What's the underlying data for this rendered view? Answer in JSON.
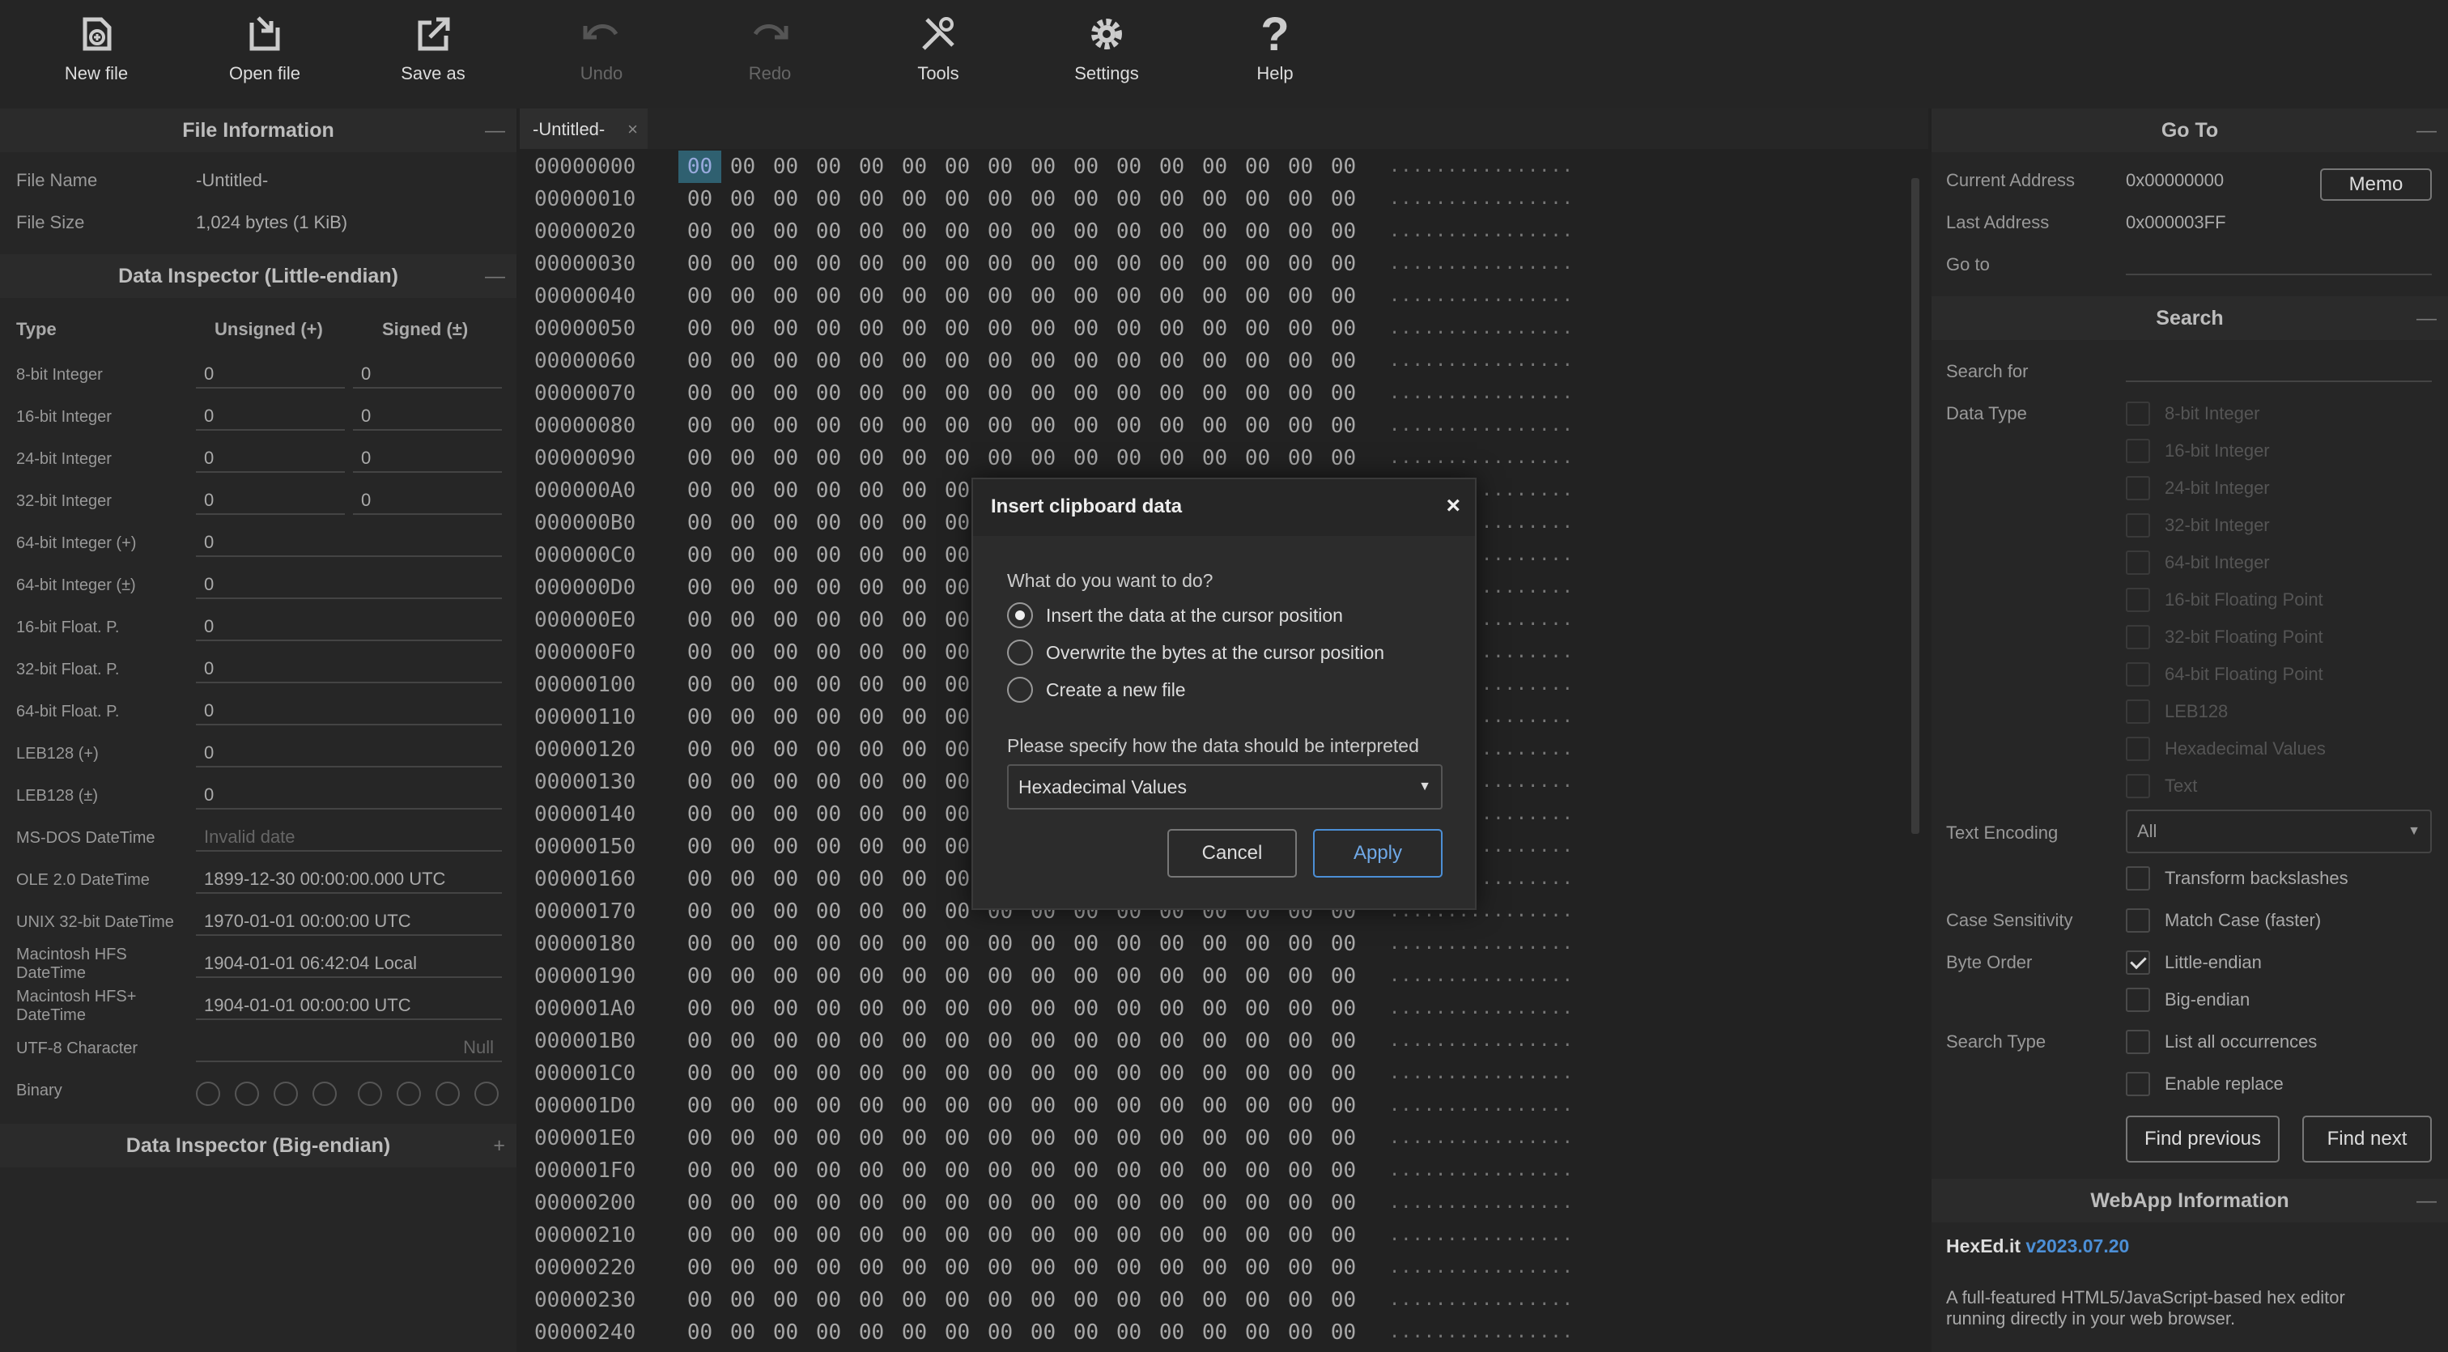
{
  "toolbar": {
    "new_file": "New file",
    "open_file": "Open file",
    "save_as": "Save as",
    "undo": "Undo",
    "redo": "Redo",
    "tools": "Tools",
    "settings": "Settings",
    "help": "Help"
  },
  "file_info": {
    "title": "File Information",
    "collapse": "—",
    "name_label": "File Name",
    "name_value": "-Untitled-",
    "size_label": "File Size",
    "size_value": "1,024 bytes (1 KiB)"
  },
  "inspector_le": {
    "title": "Data Inspector (Little-endian)",
    "collapse": "—",
    "col_type": "Type",
    "col_unsigned": "Unsigned (+)",
    "col_signed": "Signed (±)",
    "rows": [
      {
        "label": "8-bit Integer",
        "unsigned": "0",
        "signed": "0"
      },
      {
        "label": "16-bit Integer",
        "unsigned": "0",
        "signed": "0"
      },
      {
        "label": "24-bit Integer",
        "unsigned": "0",
        "signed": "0"
      },
      {
        "label": "32-bit Integer",
        "unsigned": "0",
        "signed": "0"
      },
      {
        "label": "64-bit Integer (+)",
        "value": "0"
      },
      {
        "label": "64-bit Integer (±)",
        "value": "0"
      },
      {
        "label": "16-bit Float. P.",
        "value": "0"
      },
      {
        "label": "32-bit Float. P.",
        "value": "0"
      },
      {
        "label": "64-bit Float. P.",
        "value": "0"
      },
      {
        "label": "LEB128 (+)",
        "value": "0"
      },
      {
        "label": "LEB128 (±)",
        "value": "0"
      },
      {
        "label": "MS-DOS DateTime",
        "value": "Invalid date"
      },
      {
        "label": "OLE 2.0 DateTime",
        "value": "1899-12-30 00:00:00.000 UTC"
      },
      {
        "label": "UNIX 32-bit DateTime",
        "value": "1970-01-01 00:00:00 UTC"
      },
      {
        "label": "Macintosh HFS DateTime",
        "value": "1904-01-01 06:42:04 Local"
      },
      {
        "label": "Macintosh HFS+ DateTime",
        "value": "1904-01-01 00:00:00 UTC"
      },
      {
        "label": "UTF-8 Character",
        "value": "Null"
      },
      {
        "label": "Binary"
      }
    ]
  },
  "inspector_be": {
    "title": "Data Inspector (Big-endian)",
    "expand": "+"
  },
  "editor": {
    "tab_label": "-Untitled-",
    "tab_close": "×",
    "byte": "00",
    "ascii_row": "................",
    "start_offset": 0,
    "bytes_per_row": 16,
    "selected_offset": 0,
    "visible_rows": 37
  },
  "goto": {
    "title": "Go To",
    "collapse": "—",
    "current_label": "Current Address",
    "current_value": "0x00000000",
    "memo_button": "Memo",
    "last_label": "Last Address",
    "last_value": "0x000003FF",
    "goto_label": "Go to",
    "goto_value": ""
  },
  "search": {
    "title": "Search",
    "collapse": "—",
    "search_for_label": "Search for",
    "search_for_value": "",
    "data_type_label": "Data Type",
    "data_types": [
      "8-bit Integer",
      "16-bit Integer",
      "24-bit Integer",
      "32-bit Integer",
      "64-bit Integer",
      "16-bit Floating Point",
      "32-bit Floating Point",
      "64-bit Floating Point",
      "LEB128",
      "Hexadecimal Values",
      "Text"
    ],
    "text_encoding_label": "Text Encoding",
    "text_encoding_value": "All",
    "transform_backslashes": "Transform backslashes",
    "case_label": "Case Sensitivity",
    "match_case": "Match Case (faster)",
    "byte_order_label": "Byte Order",
    "little_endian": "Little-endian",
    "big_endian": "Big-endian",
    "search_type_label": "Search Type",
    "list_all": "List all occurrences",
    "enable_replace": "Enable replace",
    "find_previous": "Find previous",
    "find_next": "Find next"
  },
  "webapp": {
    "title": "WebApp Information",
    "collapse": "—",
    "name": "HexEd.it",
    "version": "v2023.07.20",
    "description_line1": "A full-featured HTML5/JavaScript-based hex editor",
    "description_line2": "running directly in your web browser."
  },
  "dialog": {
    "title": "Insert clipboard data",
    "close": "×",
    "question": "What do you want to do?",
    "options": [
      "Insert the data at the cursor position",
      "Overwrite the bytes at the cursor position",
      "Create a new file"
    ],
    "selected_option": 0,
    "interpret_label": "Please specify how the data should be interpreted",
    "interpret_value": "Hexadecimal Values",
    "cancel": "Cancel",
    "apply": "Apply"
  },
  "colors": {
    "accent": "#4c8fd6",
    "selected_byte_bg": "#2f6070"
  }
}
